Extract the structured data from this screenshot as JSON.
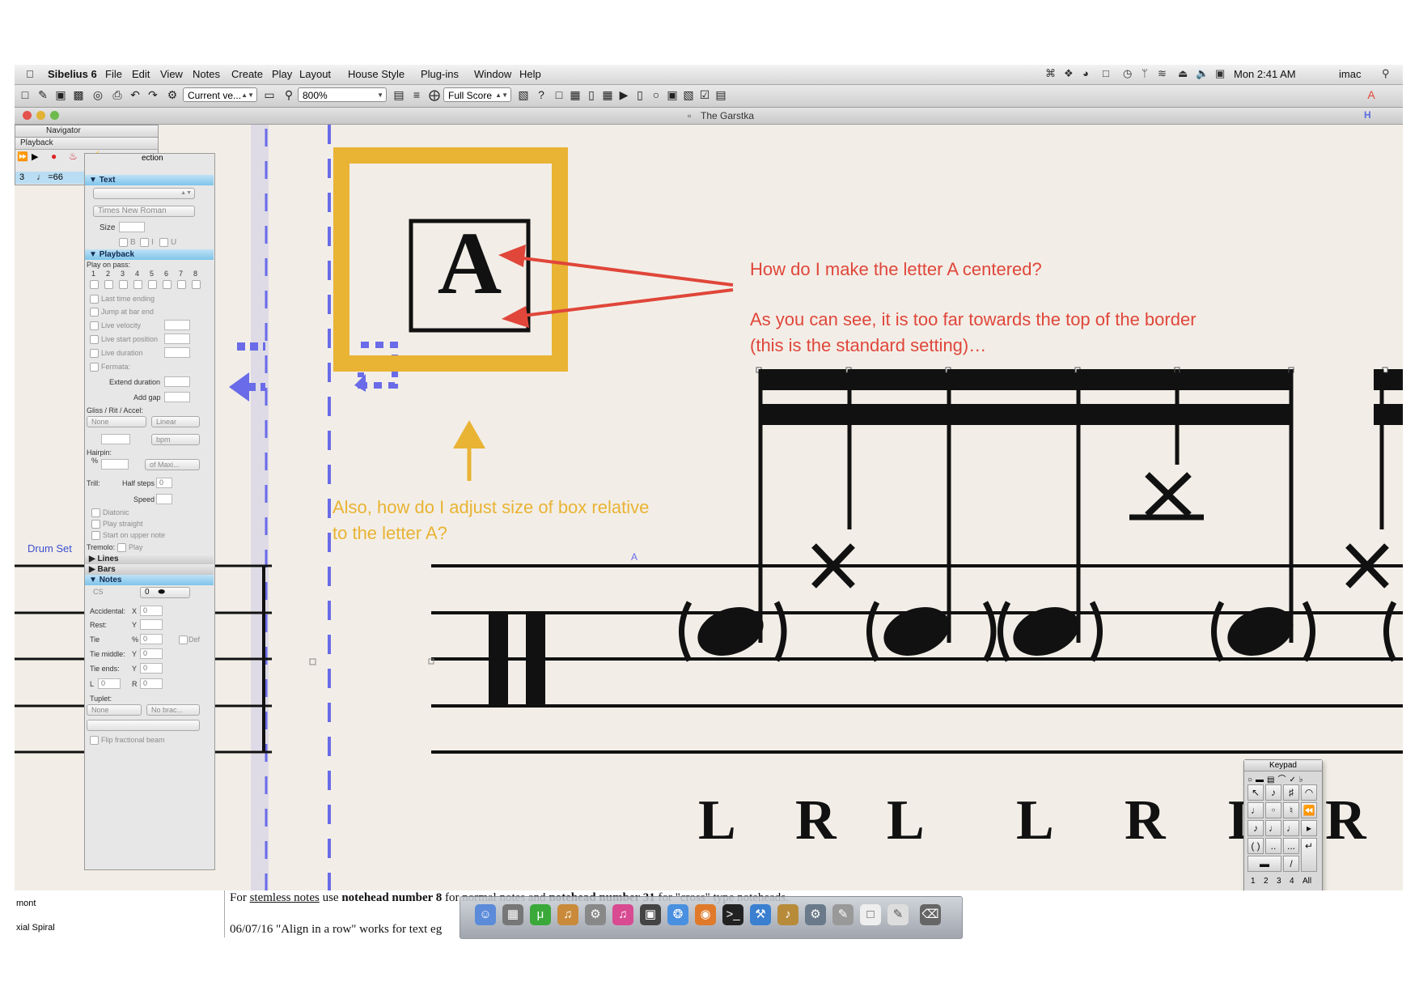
{
  "menubar": {
    "app_name": "Sibelius 6",
    "items": [
      "File",
      "Edit",
      "View",
      "Notes",
      "Create",
      "Play",
      "Layout",
      "House Style",
      "Plug-ins",
      "Window",
      "Help"
    ],
    "clock": "Mon 2:41 AM",
    "user": "imac"
  },
  "toolbar": {
    "view_select": "Current ve...",
    "zoom": "800%",
    "score_select": "Full Score"
  },
  "window": {
    "title": "The Garstka"
  },
  "navigator": {
    "title": "Navigator"
  },
  "playback_window": {
    "title": "Playback",
    "timecode": "3",
    "tempo": "♩ =66"
  },
  "properties": {
    "partial_title": "ection",
    "text_section": "Text",
    "font": "Times New Roman",
    "size_label": "Size",
    "style_bold": "B",
    "style_italic": "I",
    "style_underline": "U",
    "playback_section": "Playback",
    "play_on_pass": "Play on pass:",
    "passes": [
      "1",
      "2",
      "3",
      "4",
      "5",
      "6",
      "7",
      "8"
    ],
    "last_time_ending": "Last time ending",
    "jump_at_bar_end": "Jump at bar end",
    "live_velocity": "Live velocity",
    "live_start_position": "Live start position",
    "live_duration": "Live duration",
    "fermata": "Fermata:",
    "extend_duration": "Extend duration",
    "add_gap": "Add gap",
    "gliss_rit_accel": "Gliss / Rit / Accel:",
    "gliss_type": "None",
    "gliss_curve": "Linear",
    "bpm": "bpm",
    "hairpin": "Hairpin:",
    "hairpin_pct": "%",
    "hairpin_max": "of Maxi...",
    "trill": "Trill:",
    "half_steps": "Half steps",
    "half_steps_value": "0",
    "speed": "Speed",
    "diatonic": "Diatonic",
    "play_straight": "Play straight",
    "start_on_upper_note": "Start on upper note",
    "tremolo": "Tremolo:",
    "tremolo_play": "Play",
    "lines_section": "Lines",
    "bars_section": "Bars",
    "notes_section": "Notes",
    "notes_cs": "CS",
    "notehead_value": "0",
    "accidental": "Accidental:",
    "rest": "Rest:",
    "tie": "Tie",
    "tie_middle": "Tie middle:",
    "tie_ends": "Tie ends:",
    "axis_x": "X",
    "axis_y": "Y",
    "axis_pct": "%",
    "def": "Def",
    "l_label": "L",
    "r_label": "R",
    "zero": "0",
    "tuplet": "Tuplet:",
    "tuplet_type": "None",
    "tuplet_bracket": "No brac...",
    "flip_fractional_beam": "Flip fractional beam"
  },
  "score": {
    "instrument": "Drum Set",
    "boxed_letter": "A",
    "small_marker": "A",
    "sticking": [
      "L",
      "R",
      "L",
      "L",
      "R",
      "L",
      "R"
    ]
  },
  "annotations": {
    "question1": "How do I make the letter A centered?",
    "question2_line1": "As you can see, it is too far towards the top of the border",
    "question2_line2": " (this is the standard setting)…",
    "question3_line1": "Also, how do I adjust size of box relative",
    "question3_line2": "to the letter A?",
    "red": "#e0463a",
    "gold": "#e9b334",
    "blue": "#6a6be8"
  },
  "keypad": {
    "title": "Keypad",
    "tabs": [
      "1",
      "2",
      "3",
      "4",
      "All"
    ]
  },
  "background_doc": {
    "line1_prefix": "For ",
    "line1_link": "stemless notes",
    "line1_mid": " use ",
    "line1_bold1": "notehead number 8",
    "line1_mid2": " for normal notes and ",
    "line1_bold2": "notehead number 31",
    "line1_suffix": " for \"cross\" type noteheads.",
    "line2": "06/07/16 \"Align in a row\" works for text eg",
    "sidebar1": "mont",
    "sidebar2": "xial Spiral"
  }
}
